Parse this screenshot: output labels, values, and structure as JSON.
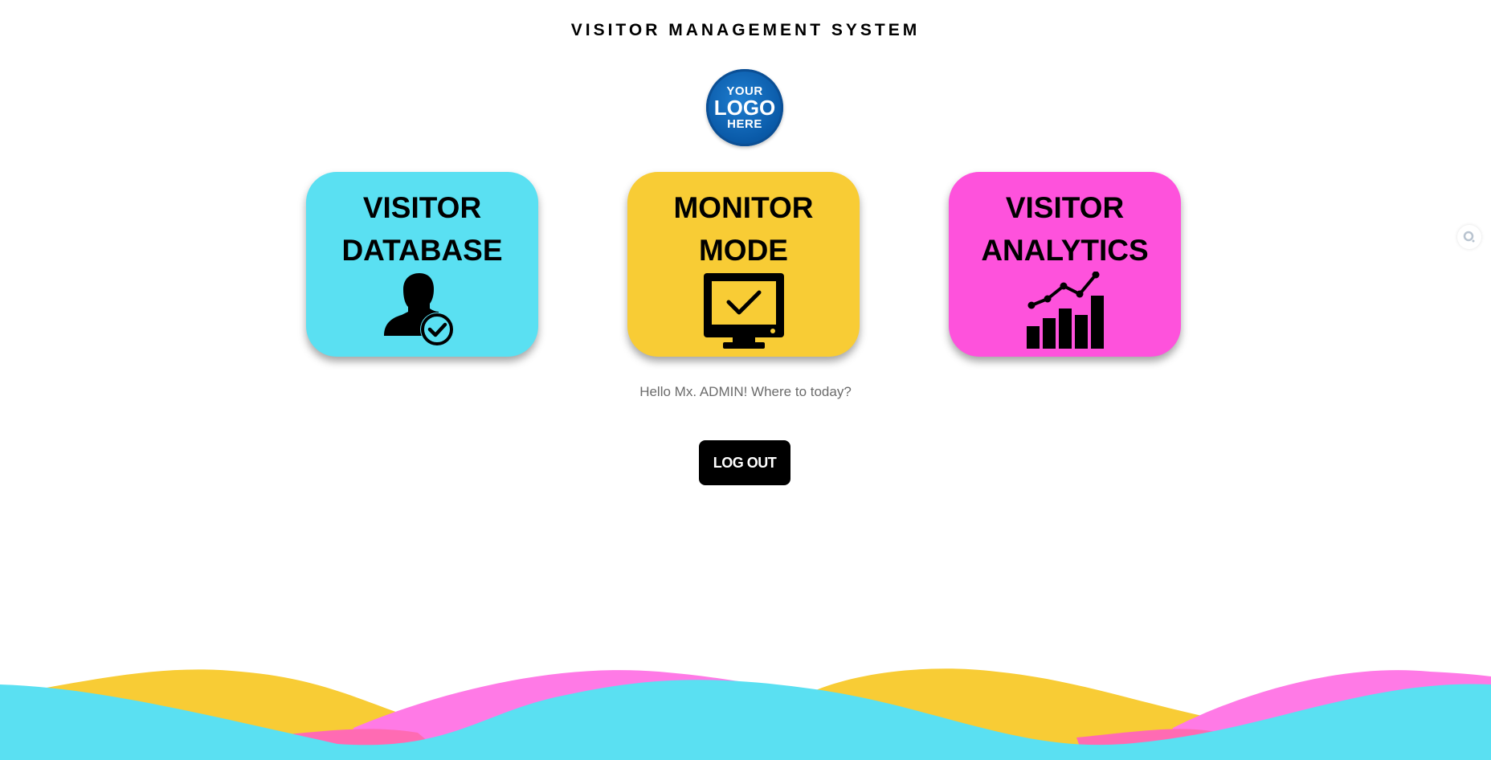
{
  "header": {
    "title": "VISITOR MANAGEMENT SYSTEM"
  },
  "logo": {
    "line1": "YOUR",
    "line2": "LOGO",
    "line3": "HERE"
  },
  "cards": [
    {
      "title_line1": "VISITOR",
      "title_line2": "DATABASE",
      "icon": "user-check-icon",
      "color": "#5ae0f2"
    },
    {
      "title_line1": "MONITOR",
      "title_line2": "MODE",
      "icon": "monitor-check-icon",
      "color": "#f8cc35"
    },
    {
      "title_line1": "VISITOR",
      "title_line2": "ANALYTICS",
      "icon": "analytics-chart-icon",
      "color": "#fe52dc"
    }
  ],
  "greeting": "Hello Mx. ADMIN! Where to today?",
  "logout_label": "LOG OUT",
  "colors": {
    "cyan": "#5ae0f2",
    "yellow": "#f8cc35",
    "pink": "#fe52dc",
    "pink_light": "#ff7ae6"
  }
}
